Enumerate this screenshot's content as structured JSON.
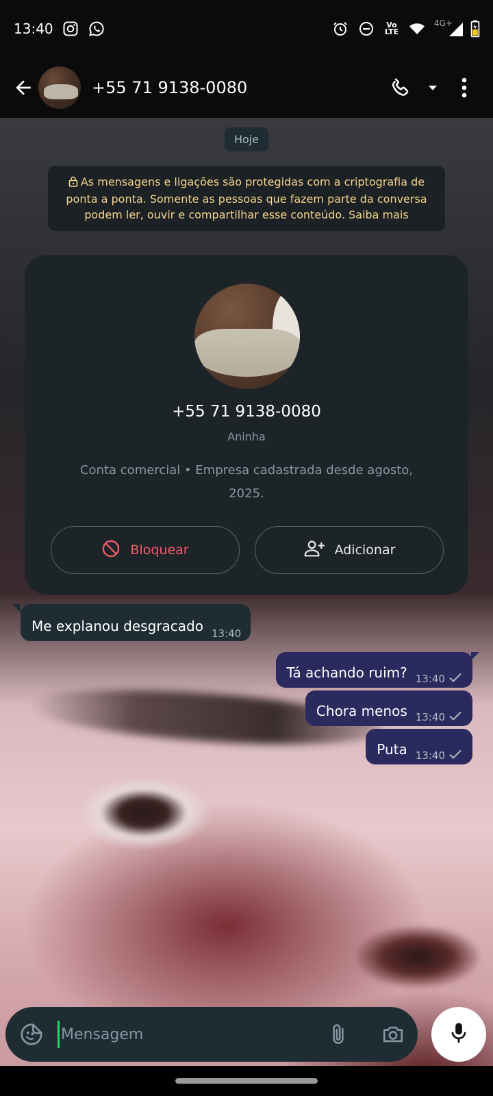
{
  "status_bar": {
    "time": "13:40",
    "icons_left": [
      "instagram-icon",
      "whatsapp-icon"
    ],
    "icons_right": [
      "alarm-icon",
      "do-not-disturb-icon",
      "volte-icon",
      "wifi-icon",
      "signal-icon",
      "battery-icon"
    ],
    "volte_text": "Vo LTE",
    "network_text": "4G+"
  },
  "header": {
    "title": "+55 71 9138-0080",
    "icons": [
      "back-arrow-icon",
      "phone-icon",
      "dropdown-icon",
      "more-vert-icon"
    ]
  },
  "chat": {
    "date_chip": "Hoje",
    "encryption_notice": "As mensagens e ligações são protegidas com a criptografia de ponta a ponta. Somente as pessoas que fazem parte da conversa podem ler, ouvir e compartilhar esse conteúdo. Saiba mais",
    "contact_card": {
      "phone": "+55 71 9138-0080",
      "name": "Aninha",
      "description": "Conta comercial • Empresa cadastrada desde agosto, 2025.",
      "block_label": "Bloquear",
      "add_label": "Adicionar"
    },
    "messages": [
      {
        "direction": "in",
        "text": "Me explanou desgracado",
        "time": "13:40"
      },
      {
        "direction": "out",
        "text": "Tá achando ruim?",
        "time": "13:40",
        "status": "sent"
      },
      {
        "direction": "out",
        "text": "Chora menos",
        "time": "13:40",
        "status": "sent"
      },
      {
        "direction": "out",
        "text": "Puta",
        "time": "13:40",
        "status": "sent"
      }
    ]
  },
  "composer": {
    "placeholder": "Mensagem",
    "value": "",
    "icons": [
      "sticker-icon",
      "attach-icon",
      "camera-icon",
      "mic-icon"
    ]
  },
  "colors": {
    "incoming_bubble": "#1f2c34",
    "outgoing_bubble": "#2b2a5e",
    "encryption_text": "#f5d48b",
    "block_red": "#f15c6d",
    "accent_green": "#25d366"
  }
}
